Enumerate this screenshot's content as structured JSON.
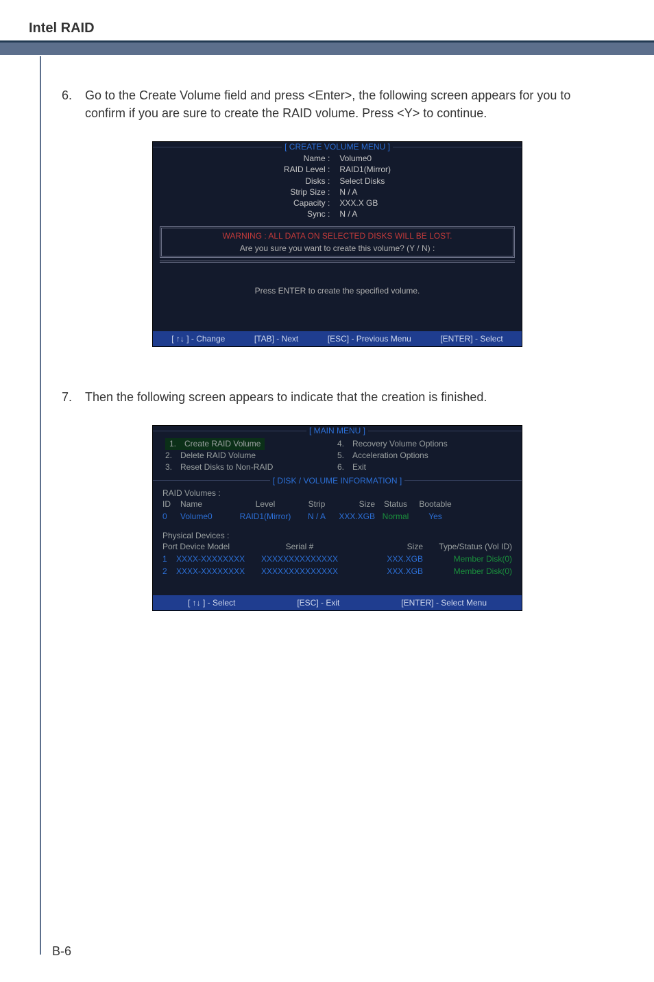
{
  "page": {
    "header_title": "Intel RAID",
    "number": "B-6"
  },
  "step6": {
    "num": "6.",
    "text": "Go to the Create Volume field and press <Enter>, the following screen appears for you to confirm if you are sure to create the RAID volume. Press <Y> to continue."
  },
  "step7": {
    "num": "7.",
    "text": "Then the following screen appears to indicate that the creation is finished."
  },
  "bios1": {
    "title": "[  CREATE VOLUME MENU  ]",
    "labels": {
      "name": "Name :",
      "raid_level": "RAID Level :",
      "disks": "Disks :",
      "strip": "Strip Size :",
      "capacity": "Capacity :",
      "sync": "Sync :"
    },
    "values": {
      "name": "Volume0",
      "raid_level": "RAID1(Mirror)",
      "disks": "Select Disks",
      "strip": "N / A",
      "capacity": "XXX.X GB",
      "sync": "N / A"
    },
    "warning": "WARNING : ALL DATA ON SELECTED DISKS WILL BE LOST.",
    "confirm": "Are  you  sure  you  want  to  create  this  volume?  (Y / N)  :",
    "press_enter": "Press  ENTER  to  create  the  specified  volume.",
    "footer": {
      "change": "[ ↑↓ ] - Change",
      "tab": "[TAB] - Next",
      "esc": "[ESC] - Previous Menu",
      "enter": "[ENTER] - Select"
    }
  },
  "bios2": {
    "main_title": "[   MAIN  MENU   ]",
    "menu_left": [
      {
        "n": "1.",
        "label": "Create  RAID  Volume",
        "sel": true
      },
      {
        "n": "2.",
        "label": "Delete  RAID  Volume",
        "sel": false
      },
      {
        "n": "3.",
        "label": "Reset Disks to Non-RAID",
        "sel": false
      }
    ],
    "menu_right": [
      {
        "n": "4.",
        "label": "Recovery Volume  Options"
      },
      {
        "n": "5.",
        "label": "Acceleration Options"
      },
      {
        "n": "6.",
        "label": "Exit"
      }
    ],
    "disk_title": "[   DISK / VOLUME INFORMATION   ]",
    "raid_volumes_label": "RAID  Volumes :",
    "vol_headers": {
      "id": "ID",
      "name": "Name",
      "level": "Level",
      "strip": "Strip",
      "size": "Size",
      "status": "Status",
      "boot": "Bootable"
    },
    "vol_row": {
      "id": "0",
      "name": "Volume0",
      "level": "RAID1(Mirror)",
      "strip": "N / A",
      "size": "XXX.XGB",
      "status": "Normal",
      "boot": "Yes"
    },
    "phys_label": "Physical  Devices :",
    "phys_headers": {
      "port": "Port  Device  Model",
      "serial": "Serial  #",
      "size": "Size",
      "type": "Type/Status (Vol  ID)"
    },
    "phys_rows": [
      {
        "n": "1",
        "model": "XXXX-XXXXXXXX",
        "serial": "XXXXXXXXXXXXXX",
        "size": "XXX.XGB",
        "type": "Member  Disk(0)"
      },
      {
        "n": "2",
        "model": "XXXX-XXXXXXXX",
        "serial": "XXXXXXXXXXXXXX",
        "size": "XXX.XGB",
        "type": "Member  Disk(0)"
      }
    ],
    "footer": {
      "select": "[ ↑↓ ] - Select",
      "esc": "[ESC] - Exit",
      "enter": "[ENTER] - Select Menu"
    }
  }
}
